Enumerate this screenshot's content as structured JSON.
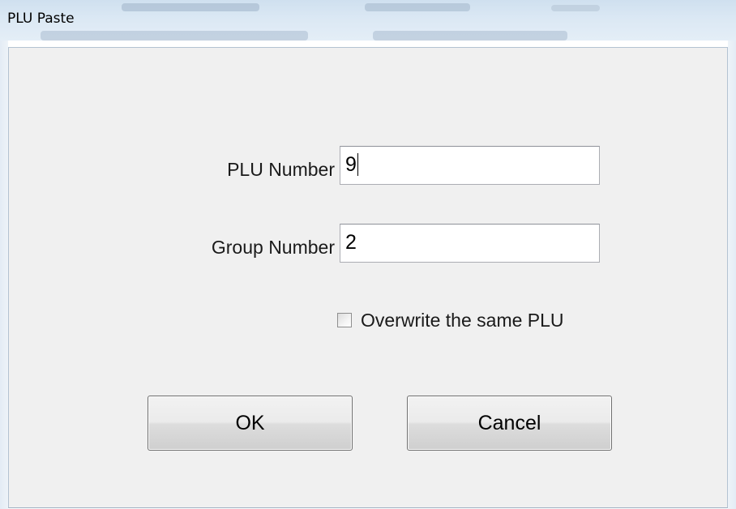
{
  "window": {
    "title": "PLU Paste"
  },
  "form": {
    "plu_label": "PLU Number",
    "plu_value": "9",
    "group_label": "Group Number",
    "group_value": "2",
    "overwrite_label": "Overwrite the same PLU",
    "overwrite_checked": false
  },
  "buttons": {
    "ok": "OK",
    "cancel": "Cancel"
  }
}
